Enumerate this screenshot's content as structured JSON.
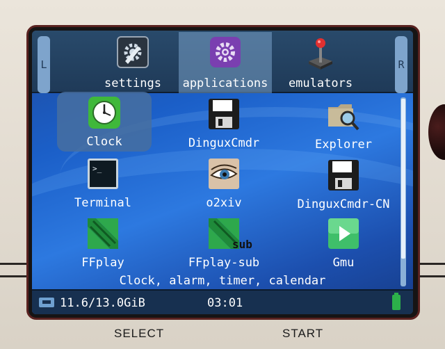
{
  "shoulders": {
    "left": "L",
    "right": "R"
  },
  "categories": [
    {
      "label": "settings",
      "icon": "settings-gear-icon"
    },
    {
      "label": "applications",
      "icon": "applications-gear-icon"
    },
    {
      "label": "emulators",
      "icon": "joystick-icon"
    }
  ],
  "active_category": "applications",
  "apps": [
    {
      "label": "Clock",
      "icon": "clock-icon"
    },
    {
      "label": "DinguxCmdr",
      "icon": "floppy-disk-icon"
    },
    {
      "label": "Explorer",
      "icon": "folder-search-icon"
    },
    {
      "label": "Terminal",
      "icon": "terminal-icon"
    },
    {
      "label": "o2xiv",
      "icon": "eye-image-viewer-icon"
    },
    {
      "label": "DinguxCmdr-CN",
      "icon": "floppy-disk-icon"
    },
    {
      "label": "FFplay",
      "icon": "ffmpeg-icon"
    },
    {
      "label": "FFplay-sub",
      "icon": "ffmpeg-sub-icon"
    },
    {
      "label": "Gmu",
      "icon": "play-icon"
    }
  ],
  "selected_app": "Clock",
  "subtitle_badge": "sub",
  "description": "Clock, alarm, timer, calendar",
  "status": {
    "storage": "11.6/13.0GiB",
    "time": "03:01"
  },
  "hardware_buttons": {
    "select": "SELECT",
    "start": "START"
  },
  "colors": {
    "selection": "#466ea0",
    "background": "#1b5fc8",
    "battery": "#2cb04a"
  }
}
